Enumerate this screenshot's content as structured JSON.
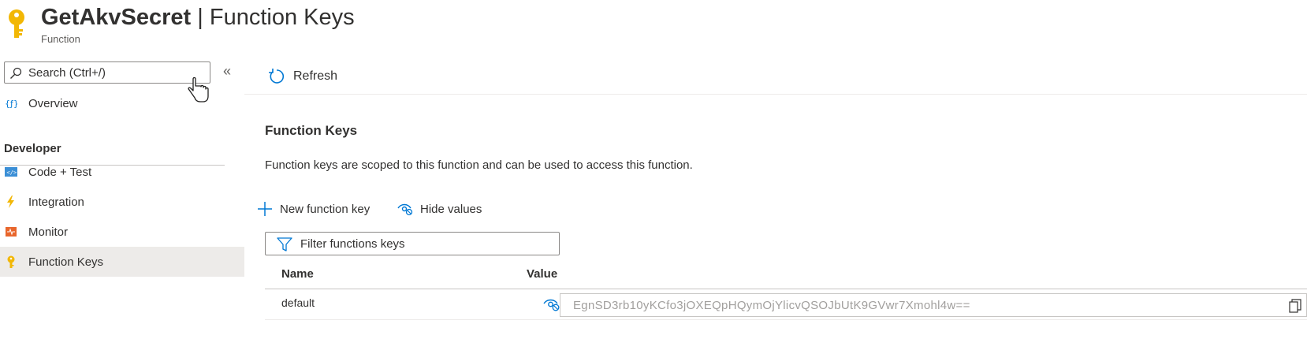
{
  "header": {
    "title_bold": "GetAkvSecret",
    "title_rest": " | Function Keys",
    "subtitle": "Function"
  },
  "sidebar": {
    "search_placeholder": "Search (Ctrl+/)",
    "collapse_label": "«",
    "overview_label": "Overview",
    "section_label": "Developer",
    "items": [
      {
        "label": "Code + Test",
        "icon": "code-icon"
      },
      {
        "label": "Integration",
        "icon": "lightning-icon"
      },
      {
        "label": "Monitor",
        "icon": "monitor-icon"
      },
      {
        "label": "Function Keys",
        "icon": "key-icon",
        "active": true
      }
    ]
  },
  "toolbar": {
    "refresh_label": "Refresh"
  },
  "main": {
    "heading": "Function Keys",
    "description": "Function keys are scoped to this function and can be used to access this function.",
    "new_key_label": "New function key",
    "hide_values_label": "Hide values",
    "filter_placeholder": "Filter functions keys",
    "columns": {
      "name": "Name",
      "value": "Value"
    },
    "rows": [
      {
        "name": "default",
        "value": "EgnSD3rb10yKCfo3jOXEQpHQymOjYlicvQSOJbUtK9GVwr7Xmohl4w=="
      }
    ]
  },
  "colors": {
    "accent": "#0078d4",
    "key_yellow": "#f2b705",
    "active_bg": "#edebe9",
    "monitor_orange": "#e8662c"
  }
}
